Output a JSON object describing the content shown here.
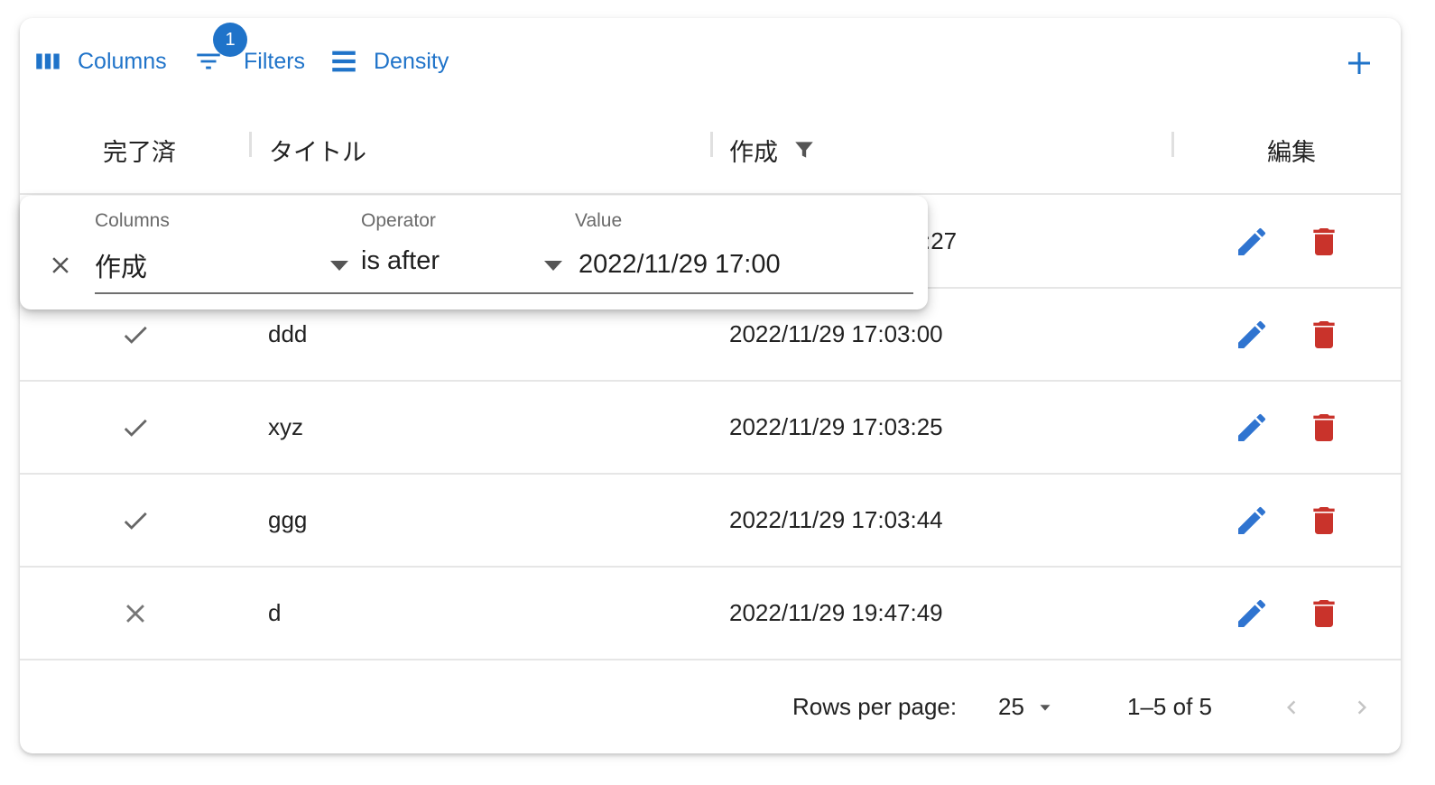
{
  "toolbar": {
    "columns_label": "Columns",
    "filters_label": "Filters",
    "filters_badge": "1",
    "density_label": "Density",
    "add_icon": "plus-icon",
    "accent_color": "#1f73c9"
  },
  "header": {
    "done": "完了済",
    "title": "タイトル",
    "created": "作成",
    "edit": "編集"
  },
  "rows": [
    {
      "done": true,
      "title": "",
      "created": ":27"
    },
    {
      "done": true,
      "title": "ddd",
      "created": "2022/11/29 17:03:00"
    },
    {
      "done": true,
      "title": "xyz",
      "created": "2022/11/29 17:03:25"
    },
    {
      "done": true,
      "title": "ggg",
      "created": "2022/11/29 17:03:44"
    },
    {
      "done": false,
      "title": "d",
      "created": "2022/11/29 19:47:49"
    }
  ],
  "filter_panel": {
    "columns_label": "Columns",
    "columns_value": "作成",
    "operator_label": "Operator",
    "operator_value": "is after",
    "value_label": "Value",
    "value_value": "2022/11/29 17:00"
  },
  "footer": {
    "rows_per_page_label": "Rows per page:",
    "rows_per_page_value": "25",
    "range": "1–5 of 5"
  },
  "colors": {
    "edit_icon": "#2f74d0",
    "delete_icon": "#c9332b"
  }
}
